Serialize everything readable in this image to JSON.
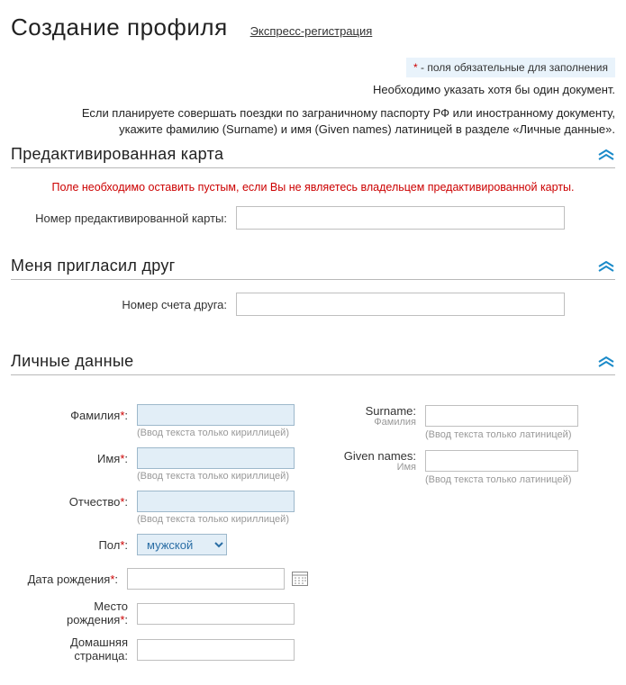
{
  "header": {
    "title": "Создание профиля",
    "express_link": "Экспресс-регистрация"
  },
  "notes": {
    "required_marker": "*",
    "required_text": " - поля обязательные для заполнения",
    "doc_note": "Необходимо указать хотя бы один документ.",
    "travel_note_line1": "Если планируете совершать поездки по заграничному паспорту РФ или иностранному документу,",
    "travel_note_line2": "укажите фамилию (Surname) и имя (Given names) латиницей в разделе «Личные данные»."
  },
  "sections": {
    "card": {
      "title": "Предактивированная карта",
      "warning": "Поле необходимо оставить пустым, если Вы не являетесь владельцем предактивированной карты.",
      "label": "Номер предактивированной карты:"
    },
    "friend": {
      "title": "Меня пригласил друг",
      "label": "Номер счета друга:"
    },
    "personal": {
      "title": "Личные данные",
      "left": {
        "surname_ru": {
          "label": "Фамилия",
          "hint": "(Ввод текста только кириллицей)"
        },
        "name_ru": {
          "label": "Имя",
          "hint": "(Ввод текста только кириллицей)"
        },
        "patronymic": {
          "label": "Отчество",
          "hint": "(Ввод текста только кириллицей)"
        },
        "gender": {
          "label": "Пол",
          "value": "мужской"
        },
        "birthdate": {
          "label": "Дата рождения"
        },
        "birthplace": {
          "label_l1": "Место",
          "label_l2": "рождения"
        },
        "homepage": {
          "label_l1": "Домашняя",
          "label_l2": "страница"
        }
      },
      "right": {
        "surname_en": {
          "label": "Surname:",
          "sub": "Фамилия",
          "hint": "(Ввод текста только латиницей)"
        },
        "given_en": {
          "label": "Given names:",
          "sub": "Имя",
          "hint": "(Ввод текста только латиницей)"
        }
      }
    }
  }
}
